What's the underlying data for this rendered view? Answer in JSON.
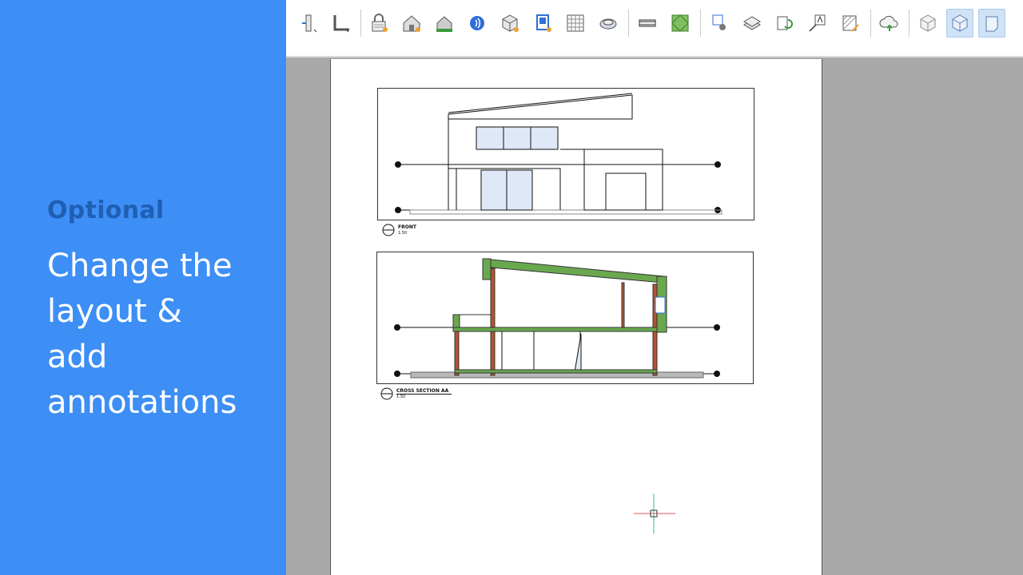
{
  "panel": {
    "tag": "Optional",
    "headline_lines": [
      "Change the",
      "layout &",
      "add",
      "annotations"
    ]
  },
  "toolbar": {
    "tools": [
      {
        "name": "wall-sweep-icon"
      },
      {
        "name": "wall-reveal-icon"
      },
      {
        "name": "lock-icon"
      },
      {
        "name": "house-icon"
      },
      {
        "name": "house-elevation-icon"
      },
      {
        "name": "audio-icon"
      },
      {
        "name": "cube-shade-icon"
      },
      {
        "name": "sheet-icon"
      },
      {
        "name": "grid-schedule-icon"
      },
      {
        "name": "roll-icon"
      },
      {
        "name": "beam-icon"
      },
      {
        "name": "green-surface-icon"
      },
      {
        "name": "tag-person-icon"
      },
      {
        "name": "stack-icon"
      },
      {
        "name": "refresh-sheet-icon"
      },
      {
        "name": "text-note-icon"
      },
      {
        "name": "hatch-edit-icon"
      },
      {
        "name": "cloud-upload-icon"
      },
      {
        "name": "cube-icon"
      },
      {
        "name": "cube-selected-icon"
      },
      {
        "name": "section-box-icon"
      }
    ],
    "active_tools": [
      "cube-selected-icon",
      "section-box-icon"
    ]
  },
  "drawing": {
    "views": [
      {
        "title": "FRONT",
        "scale": "1:50"
      },
      {
        "title": "CROSS SECTION AA",
        "scale": "1:50"
      }
    ],
    "colors": {
      "accent": "#3d8ef5",
      "insulation": "#6aa84f",
      "structure": "#b5532e"
    }
  }
}
